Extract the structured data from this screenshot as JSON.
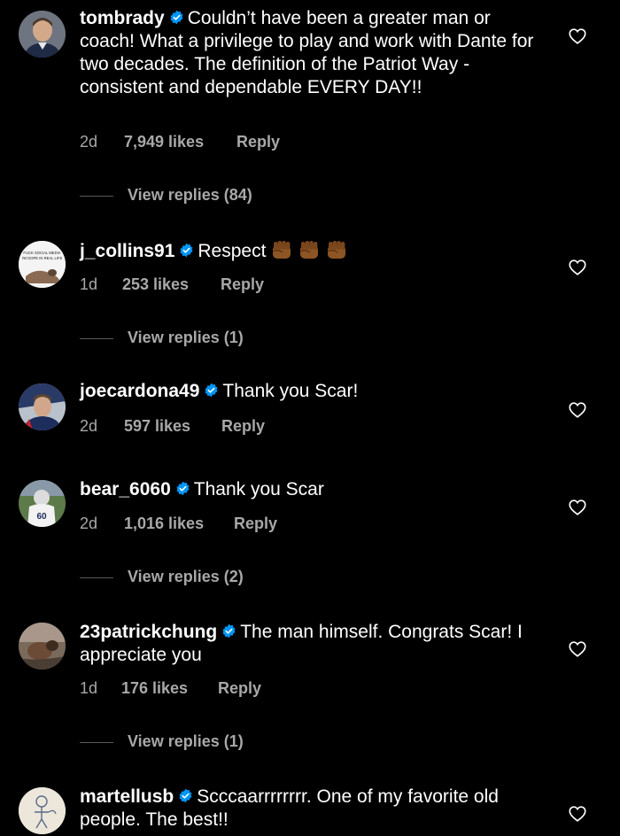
{
  "comments": [
    {
      "username": "tombrady",
      "text": "Couldn’t have been a greater man or coach! What a privilege to play and work with Dante for two decades. The definition of the Patriot Way - consistent and dependable EVERY DAY!!",
      "time": "2d",
      "likes": "7,949 likes",
      "reply": "Reply",
      "view_replies": "View replies (84)"
    },
    {
      "username": "j_collins91",
      "text": "Respect",
      "avatar_text": "FUCK SOCIAL MEDIA I'M DOPE IN REAL LIFE",
      "emoji": [
        "raised-fist-medium-dark",
        "raised-fist-medium-dark",
        "raised-fist-medium-dark"
      ],
      "time": "1d",
      "likes": "253 likes",
      "reply": "Reply",
      "view_replies": "View replies (1)"
    },
    {
      "username": "joecardona49",
      "text": "Thank you Scar!",
      "time": "2d",
      "likes": "597 likes",
      "reply": "Reply"
    },
    {
      "username": "bear_6060",
      "text": "Thank you Scar",
      "time": "2d",
      "likes": "1,016 likes",
      "reply": "Reply",
      "view_replies": "View replies (2)"
    },
    {
      "username": "23patrickchung",
      "text": "The man himself. Congrats Scar! I appreciate you",
      "time": "1d",
      "likes": "176 likes",
      "reply": "Reply",
      "view_replies": "View replies (1)"
    },
    {
      "username": "martellusb",
      "text": "Scccaarrrrrrrr. One of my favorite old people. The best!!"
    }
  ],
  "icons": {
    "verified": "verified-badge-icon",
    "like": "heart-outline-icon"
  },
  "colors": {
    "background": "#000000",
    "text": "#ffffff",
    "secondary_text": "#a8a8a8",
    "verified_blue": "#0095f6",
    "fist_skin": "#8d5524"
  }
}
